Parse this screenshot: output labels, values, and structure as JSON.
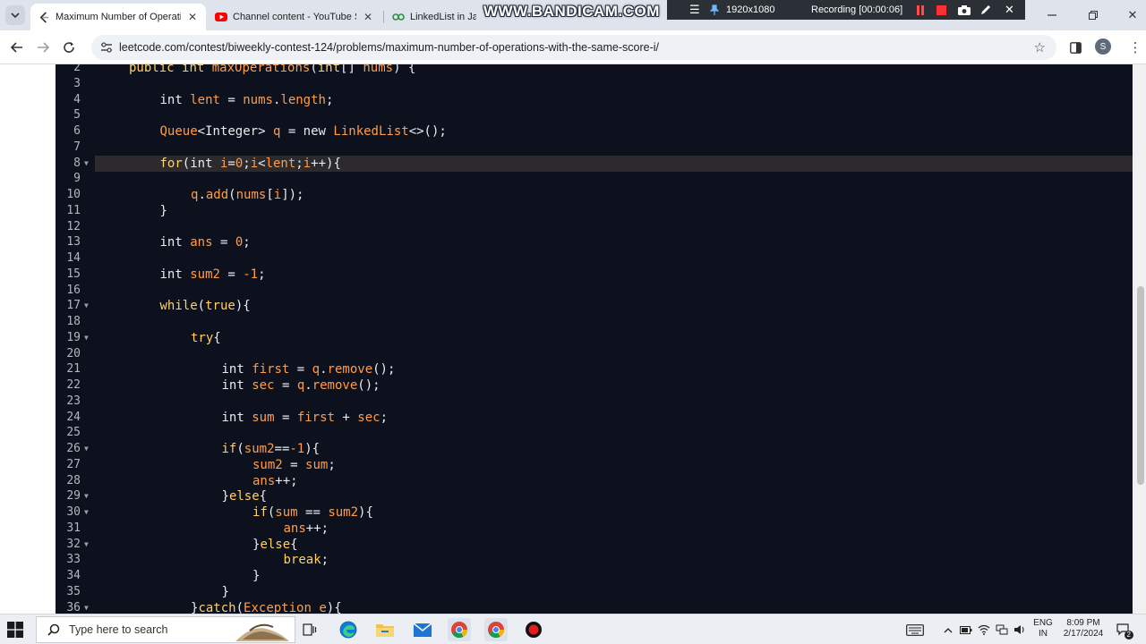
{
  "browser": {
    "tabs": [
      {
        "title": "Maximum Number of Operations",
        "favicon": "leetcode-icon",
        "active": true
      },
      {
        "title": "Channel content - YouTube Studio",
        "favicon": "youtube-icon",
        "active": false
      },
      {
        "title": "LinkedList in Java",
        "favicon": "gfg-icon",
        "active": false
      }
    ],
    "url": "leetcode.com/contest/biweekly-contest-124/problems/maximum-number-of-operations-with-the-same-score-i/",
    "profile_initial": "S"
  },
  "recorder": {
    "watermark": "WWW.BANDICAM.COM",
    "resolution": "1920x1080",
    "status": "Recording [00:00:06]"
  },
  "editor": {
    "active_line": 8,
    "lines": [
      {
        "n": "2",
        "fold": false,
        "indent": 1,
        "tokens": [
          [
            "kw",
            "public "
          ],
          [
            "kw",
            "int "
          ],
          [
            "id",
            "maxOperations"
          ],
          [
            "pl",
            "("
          ],
          [
            "kw",
            "int"
          ],
          [
            "pl",
            "[] "
          ],
          [
            "id",
            "nums"
          ],
          [
            "pl",
            ") {"
          ]
        ]
      },
      {
        "n": "3",
        "fold": false,
        "indent": 0,
        "tokens": []
      },
      {
        "n": "4",
        "fold": false,
        "indent": 2,
        "tokens": [
          [
            "pl",
            "int "
          ],
          [
            "id",
            "lent"
          ],
          [
            "pl",
            " = "
          ],
          [
            "id",
            "nums"
          ],
          [
            "pl",
            "."
          ],
          [
            "id",
            "length"
          ],
          [
            "pl",
            ";"
          ]
        ]
      },
      {
        "n": "5",
        "fold": false,
        "indent": 0,
        "tokens": []
      },
      {
        "n": "6",
        "fold": false,
        "indent": 2,
        "tokens": [
          [
            "id",
            "Queue"
          ],
          [
            "pl",
            "<Integer> "
          ],
          [
            "id",
            "q"
          ],
          [
            "pl",
            " = new "
          ],
          [
            "id",
            "LinkedList"
          ],
          [
            "pl",
            "<>();"
          ]
        ]
      },
      {
        "n": "7",
        "fold": false,
        "indent": 0,
        "tokens": []
      },
      {
        "n": "8",
        "fold": true,
        "indent": 2,
        "tokens": [
          [
            "kw",
            "for"
          ],
          [
            "pl",
            "(int "
          ],
          [
            "id",
            "i"
          ],
          [
            "pl",
            "="
          ],
          [
            "id",
            "0"
          ],
          [
            "pl",
            ";"
          ],
          [
            "id",
            "i"
          ],
          [
            "pl",
            "<"
          ],
          [
            "id",
            "lent"
          ],
          [
            "pl",
            ";"
          ],
          [
            "id",
            "i"
          ],
          [
            "pl",
            "++){"
          ]
        ]
      },
      {
        "n": "9",
        "fold": false,
        "indent": 0,
        "tokens": []
      },
      {
        "n": "10",
        "fold": false,
        "indent": 3,
        "tokens": [
          [
            "id",
            "q"
          ],
          [
            "pl",
            "."
          ],
          [
            "id",
            "add"
          ],
          [
            "pl",
            "("
          ],
          [
            "id",
            "nums"
          ],
          [
            "pl",
            "["
          ],
          [
            "id",
            "i"
          ],
          [
            "pl",
            "]);"
          ]
        ]
      },
      {
        "n": "11",
        "fold": false,
        "indent": 2,
        "tokens": [
          [
            "pl",
            "}"
          ]
        ]
      },
      {
        "n": "12",
        "fold": false,
        "indent": 0,
        "tokens": []
      },
      {
        "n": "13",
        "fold": false,
        "indent": 2,
        "tokens": [
          [
            "pl",
            "int "
          ],
          [
            "id",
            "ans"
          ],
          [
            "pl",
            " = "
          ],
          [
            "id",
            "0"
          ],
          [
            "pl",
            ";"
          ]
        ]
      },
      {
        "n": "14",
        "fold": false,
        "indent": 0,
        "tokens": []
      },
      {
        "n": "15",
        "fold": false,
        "indent": 2,
        "tokens": [
          [
            "pl",
            "int "
          ],
          [
            "id",
            "sum2"
          ],
          [
            "pl",
            " = "
          ],
          [
            "id",
            "-1"
          ],
          [
            "pl",
            ";"
          ]
        ]
      },
      {
        "n": "16",
        "fold": false,
        "indent": 0,
        "tokens": []
      },
      {
        "n": "17",
        "fold": true,
        "indent": 2,
        "tokens": [
          [
            "kw",
            "while"
          ],
          [
            "pl",
            "("
          ],
          [
            "kw",
            "true"
          ],
          [
            "pl",
            "){"
          ]
        ]
      },
      {
        "n": "18",
        "fold": false,
        "indent": 0,
        "tokens": []
      },
      {
        "n": "19",
        "fold": true,
        "indent": 3,
        "tokens": [
          [
            "kw",
            "try"
          ],
          [
            "pl",
            "{"
          ]
        ]
      },
      {
        "n": "20",
        "fold": false,
        "indent": 0,
        "tokens": []
      },
      {
        "n": "21",
        "fold": false,
        "indent": 4,
        "tokens": [
          [
            "pl",
            "int "
          ],
          [
            "id",
            "first"
          ],
          [
            "pl",
            " = "
          ],
          [
            "id",
            "q"
          ],
          [
            "pl",
            "."
          ],
          [
            "id",
            "remove"
          ],
          [
            "pl",
            "();"
          ]
        ]
      },
      {
        "n": "22",
        "fold": false,
        "indent": 4,
        "tokens": [
          [
            "pl",
            "int "
          ],
          [
            "id",
            "sec"
          ],
          [
            "pl",
            " = "
          ],
          [
            "id",
            "q"
          ],
          [
            "pl",
            "."
          ],
          [
            "id",
            "remove"
          ],
          [
            "pl",
            "();"
          ]
        ]
      },
      {
        "n": "23",
        "fold": false,
        "indent": 0,
        "tokens": []
      },
      {
        "n": "24",
        "fold": false,
        "indent": 4,
        "tokens": [
          [
            "pl",
            "int "
          ],
          [
            "id",
            "sum"
          ],
          [
            "pl",
            " = "
          ],
          [
            "id",
            "first"
          ],
          [
            "pl",
            " + "
          ],
          [
            "id",
            "sec"
          ],
          [
            "pl",
            ";"
          ]
        ]
      },
      {
        "n": "25",
        "fold": false,
        "indent": 0,
        "tokens": []
      },
      {
        "n": "26",
        "fold": true,
        "indent": 4,
        "tokens": [
          [
            "kw",
            "if"
          ],
          [
            "pl",
            "("
          ],
          [
            "id",
            "sum2"
          ],
          [
            "pl",
            "=="
          ],
          [
            "id",
            "-1"
          ],
          [
            "pl",
            "){"
          ]
        ]
      },
      {
        "n": "27",
        "fold": false,
        "indent": 5,
        "tokens": [
          [
            "id",
            "sum2"
          ],
          [
            "pl",
            " = "
          ],
          [
            "id",
            "sum"
          ],
          [
            "pl",
            ";"
          ]
        ]
      },
      {
        "n": "28",
        "fold": false,
        "indent": 5,
        "tokens": [
          [
            "id",
            "ans"
          ],
          [
            "pl",
            "++;"
          ]
        ]
      },
      {
        "n": "29",
        "fold": true,
        "indent": 4,
        "tokens": [
          [
            "pl",
            "}"
          ],
          [
            "kw",
            "else"
          ],
          [
            "pl",
            "{"
          ]
        ]
      },
      {
        "n": "30",
        "fold": true,
        "indent": 5,
        "tokens": [
          [
            "kw",
            "if"
          ],
          [
            "pl",
            "("
          ],
          [
            "id",
            "sum"
          ],
          [
            "pl",
            " == "
          ],
          [
            "id",
            "sum2"
          ],
          [
            "pl",
            "){"
          ]
        ]
      },
      {
        "n": "31",
        "fold": false,
        "indent": 6,
        "tokens": [
          [
            "id",
            "ans"
          ],
          [
            "pl",
            "++;"
          ]
        ]
      },
      {
        "n": "32",
        "fold": true,
        "indent": 5,
        "tokens": [
          [
            "pl",
            "}"
          ],
          [
            "kw",
            "else"
          ],
          [
            "pl",
            "{"
          ]
        ]
      },
      {
        "n": "33",
        "fold": false,
        "indent": 6,
        "tokens": [
          [
            "kw",
            "break"
          ],
          [
            "pl",
            ";"
          ]
        ]
      },
      {
        "n": "34",
        "fold": false,
        "indent": 5,
        "tokens": [
          [
            "pl",
            "}"
          ]
        ]
      },
      {
        "n": "35",
        "fold": false,
        "indent": 4,
        "tokens": [
          [
            "pl",
            "}"
          ]
        ]
      },
      {
        "n": "36",
        "fold": true,
        "indent": 3,
        "tokens": [
          [
            "pl",
            "}"
          ],
          [
            "kw",
            "catch"
          ],
          [
            "pl",
            "("
          ],
          [
            "id",
            "Exception"
          ],
          [
            "pl",
            " "
          ],
          [
            "id",
            "e"
          ],
          [
            "pl",
            "){"
          ]
        ]
      }
    ]
  },
  "taskbar": {
    "search_placeholder": "Type here to search",
    "apps": [
      "task-view-icon",
      "edge-icon",
      "file-explorer-icon",
      "mail-icon",
      "chrome-icon",
      "chrome-icon",
      "bandicam-icon"
    ],
    "lang_top": "ENG",
    "lang_bottom": "IN",
    "time": "8:09 PM",
    "date": "2/17/2024",
    "notification_count": "2"
  },
  "colors": {
    "editor_bg": "#0c111d",
    "keyword": "#ffd166",
    "identifier": "#ff9d4a",
    "plain": "#e9ecf1",
    "active_line": "#2c2a2c"
  }
}
